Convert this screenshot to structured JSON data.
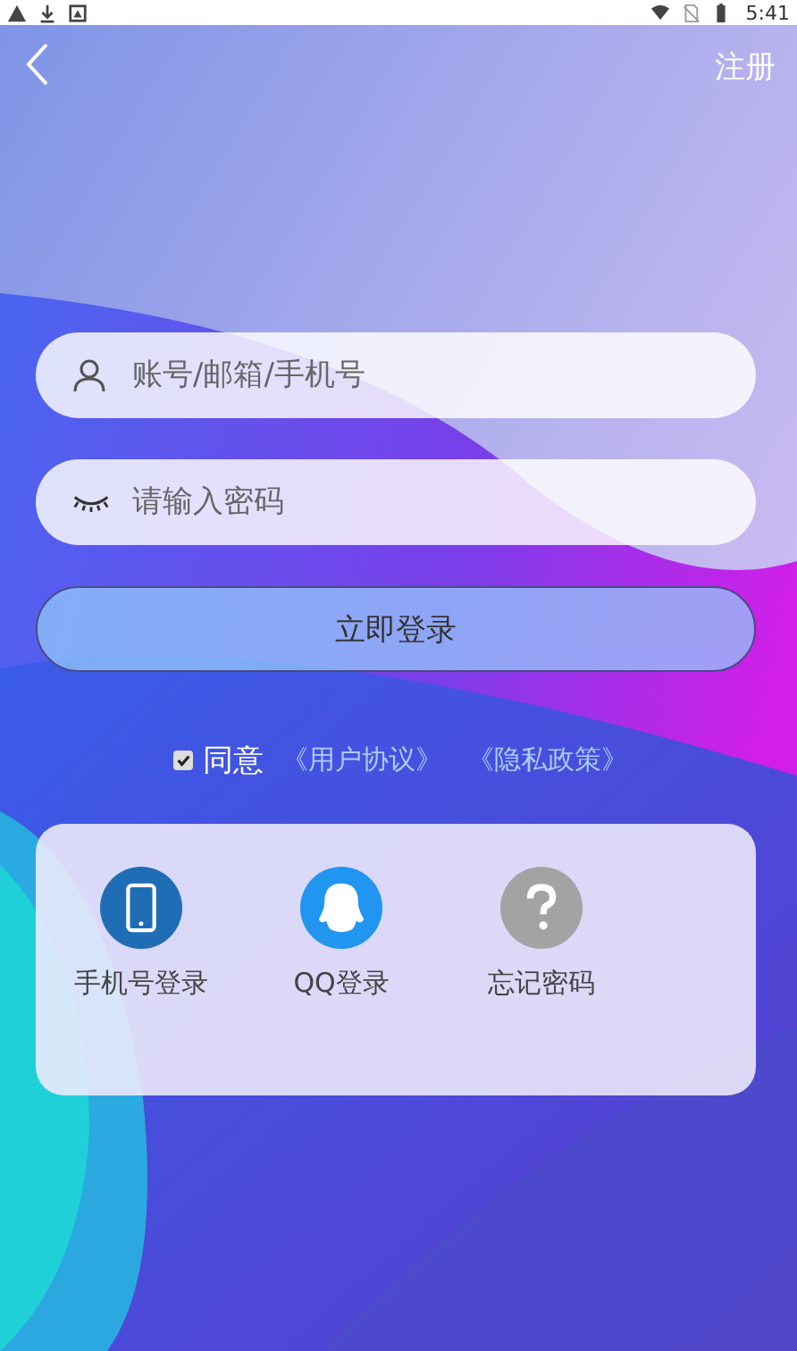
{
  "status_bar": {
    "time": "5:41"
  },
  "header": {
    "action": "注册"
  },
  "fields": [
    {
      "kind": "account",
      "placeholder": "账号/邮箱/手机号"
    },
    {
      "kind": "password",
      "placeholder": "请输入密码"
    }
  ],
  "login_button": "立即登录",
  "agreement": {
    "checked": true,
    "label": "同意",
    "links": [
      "《用户协议》",
      "《隐私政策》"
    ]
  },
  "options": [
    {
      "kind": "phone",
      "label": "手机号登录",
      "color": "#1f6db5"
    },
    {
      "kind": "qq",
      "label": "QQ登录",
      "color": "#2196f0"
    },
    {
      "kind": "help",
      "label": "忘记密码",
      "color": "#a3a3a3"
    }
  ]
}
